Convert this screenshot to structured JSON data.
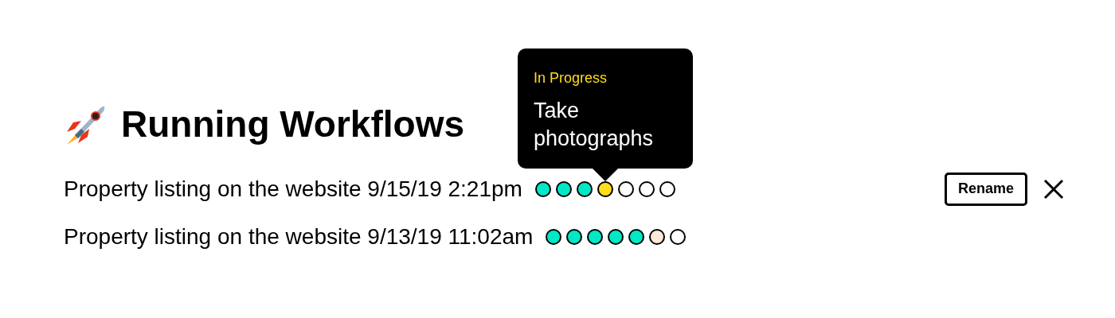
{
  "title": "Running Workflows",
  "workflows": [
    {
      "name": "Property listing on the website 9/15/19 2:21pm",
      "rename_label": "Rename",
      "closable": true,
      "steps": [
        {
          "color": "#00e8c6"
        },
        {
          "color": "#00e8c6"
        },
        {
          "color": "#00e8c6"
        },
        {
          "color": "#ffdd1a",
          "tooltip": {
            "status": "In Progress",
            "text": "Take photographs"
          }
        },
        {
          "color": "#ffffff"
        },
        {
          "color": "#ffffff"
        },
        {
          "color": "#ffffff"
        }
      ]
    },
    {
      "name": "Property listing on the website 9/13/19 11:02am",
      "steps": [
        {
          "color": "#00e8c6"
        },
        {
          "color": "#00e8c6"
        },
        {
          "color": "#00e8c6"
        },
        {
          "color": "#00e8c6"
        },
        {
          "color": "#00e8c6"
        },
        {
          "color": "#fde8d9"
        },
        {
          "color": "#ffffff"
        }
      ]
    }
  ]
}
